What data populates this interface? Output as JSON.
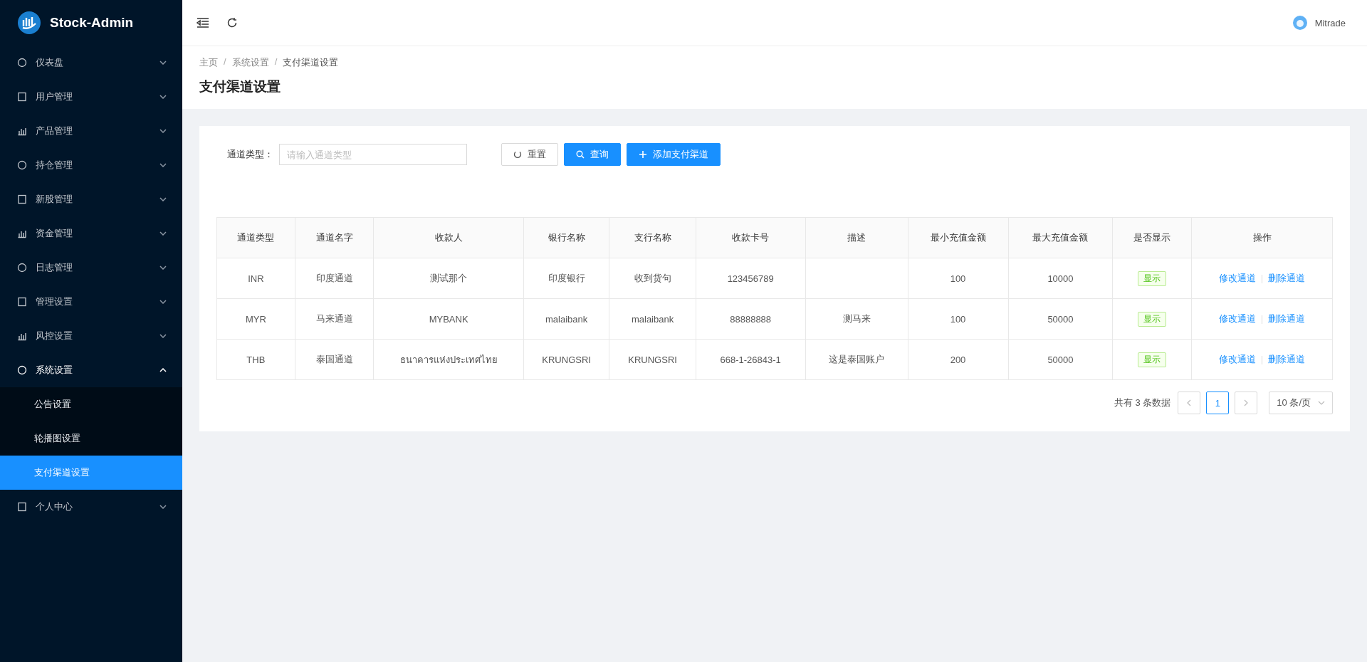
{
  "brand": {
    "title": "Stock-Admin"
  },
  "sidebar": {
    "items": [
      {
        "label": "仪表盘",
        "expanded": false
      },
      {
        "label": "用户管理",
        "expanded": false
      },
      {
        "label": "产品管理",
        "expanded": false
      },
      {
        "label": "持仓管理",
        "expanded": false
      },
      {
        "label": "新股管理",
        "expanded": false
      },
      {
        "label": "资金管理",
        "expanded": false
      },
      {
        "label": "日志管理",
        "expanded": false
      },
      {
        "label": "管理设置",
        "expanded": false
      },
      {
        "label": "风控设置",
        "expanded": false
      },
      {
        "label": "系统设置",
        "expanded": true,
        "children": [
          {
            "label": "公告设置",
            "selected": false
          },
          {
            "label": "轮播图设置",
            "selected": false
          },
          {
            "label": "支付渠道设置",
            "selected": true
          }
        ]
      },
      {
        "label": "个人中心",
        "expanded": false
      }
    ]
  },
  "header": {
    "user": "Mitrade"
  },
  "breadcrumb": [
    {
      "label": "主页",
      "kind": "link"
    },
    {
      "label": "/",
      "kind": "separator"
    },
    {
      "label": "系统设置",
      "kind": "link"
    },
    {
      "label": "/",
      "kind": "separator"
    },
    {
      "label": "支付渠道设置",
      "kind": "current"
    }
  ],
  "page_title": "支付渠道设置",
  "filter": {
    "label": "通道类型：",
    "placeholder": "请输入通道类型",
    "buttons": [
      {
        "label": "重置",
        "kind": "reset"
      },
      {
        "label": "查询",
        "kind": "search"
      },
      {
        "label": "添加支付渠道",
        "kind": "add"
      }
    ]
  },
  "table": {
    "columns": [
      "通道类型",
      "通道名字",
      "收款人",
      "银行名称",
      "支行名称",
      "收款卡号",
      "描述",
      "最小充值金额",
      "最大充值金额",
      "是否显示",
      "操作"
    ],
    "rows": [
      {
        "cells": [
          "INR",
          "印度通道",
          "测试那个",
          "印度银行",
          "收到货句",
          "123456789",
          "",
          "100",
          "10000"
        ],
        "display": "显示",
        "actions": [
          "修改通道",
          "删除通道"
        ]
      },
      {
        "cells": [
          "MYR",
          "马来通道",
          "MYBANK",
          "malaibank",
          "malaibank",
          "88888888",
          "测马来",
          "100",
          "50000"
        ],
        "display": "显示",
        "actions": [
          "修改通道",
          "删除通道"
        ]
      },
      {
        "cells": [
          "THB",
          "泰国通道",
          "ธนาคารแห่งประเทศไทย",
          "KRUNGSRI",
          "KRUNGSRI",
          "668-1-26843-1",
          "这是泰国账户",
          "200",
          "50000"
        ],
        "display": "显示",
        "actions": [
          "修改通道",
          "删除通道"
        ]
      }
    ]
  },
  "pagination": {
    "total": "共有 3 条数据",
    "pages": [
      {
        "label": "1",
        "selected": true
      }
    ],
    "page_size": "10 条/页"
  }
}
